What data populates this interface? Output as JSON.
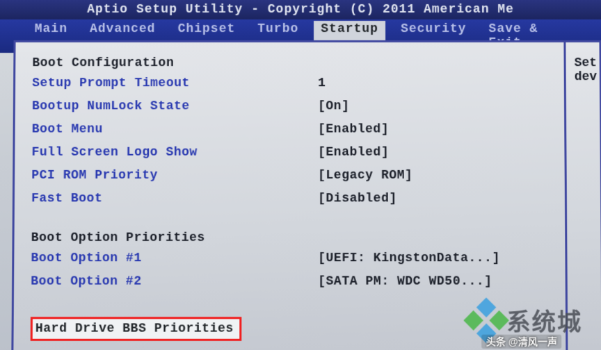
{
  "titlebar": "Aptio Setup Utility - Copyright (C) 2011 American Me",
  "menu": {
    "items": [
      "Main",
      "Advanced",
      "Chipset",
      "Turbo",
      "Startup",
      "Security",
      "Save & Exit"
    ],
    "active_index": 4
  },
  "boot_config": {
    "heading": "Boot Configuration",
    "rows": [
      {
        "label": "Setup Prompt Timeout",
        "value": "1"
      },
      {
        "label": "Bootup NumLock State",
        "value": "[On]"
      },
      {
        "label": "Boot Menu",
        "value": "[Enabled]"
      },
      {
        "label": "Full Screen Logo Show",
        "value": "[Enabled]"
      },
      {
        "label": "PCI ROM Priority",
        "value": "[Legacy ROM]"
      },
      {
        "label": "Fast Boot",
        "value": "[Disabled]"
      }
    ]
  },
  "boot_priorities": {
    "heading": "Boot Option Priorities",
    "rows": [
      {
        "label": "Boot Option #1",
        "value": "[UEFI: KingstonData...]"
      },
      {
        "label": "Boot Option #2",
        "value": "[SATA  PM: WDC WD50...]"
      }
    ]
  },
  "selected": {
    "label": "Hard Drive BBS Priorities"
  },
  "help": {
    "line1": "Set",
    "line2": "dev"
  },
  "watermark": {
    "text": "系统城",
    "sub": "头条 @清风一声"
  }
}
